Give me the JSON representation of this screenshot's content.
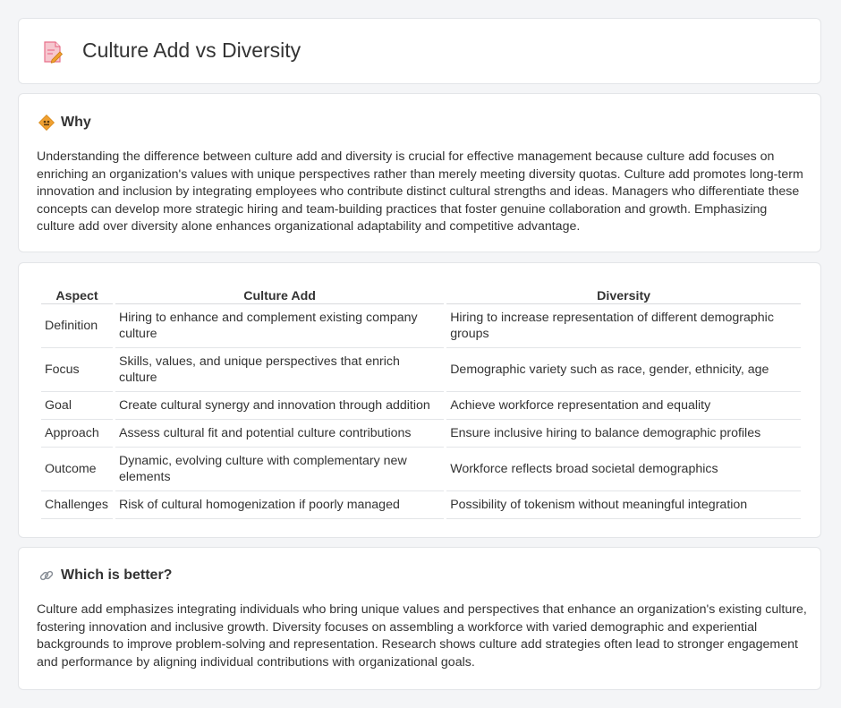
{
  "header": {
    "title": "Culture Add vs Diversity",
    "icon": "document-pencil-icon"
  },
  "why": {
    "title": "Why",
    "icon": "diamond-warning-icon",
    "text": "Understanding the difference between culture add and diversity is crucial for effective management because culture add focuses on enriching an organization's values with unique perspectives rather than merely meeting diversity quotas. Culture add promotes long-term innovation and inclusion by integrating employees who contribute distinct cultural strengths and ideas. Managers who differentiate these concepts can develop more strategic hiring and team-building practices that foster genuine collaboration and growth. Emphasizing culture add over diversity alone enhances organizational adaptability and competitive advantage."
  },
  "table": {
    "headers": [
      "Aspect",
      "Culture Add",
      "Diversity"
    ],
    "rows": [
      {
        "aspect": "Definition",
        "culture_add": "Hiring to enhance and complement existing company culture",
        "diversity": "Hiring to increase representation of different demographic groups"
      },
      {
        "aspect": "Focus",
        "culture_add": "Skills, values, and unique perspectives that enrich culture",
        "diversity": "Demographic variety such as race, gender, ethnicity, age"
      },
      {
        "aspect": "Goal",
        "culture_add": "Create cultural synergy and innovation through addition",
        "diversity": "Achieve workforce representation and equality"
      },
      {
        "aspect": "Approach",
        "culture_add": "Assess cultural fit and potential culture contributions",
        "diversity": "Ensure inclusive hiring to balance demographic profiles"
      },
      {
        "aspect": "Outcome",
        "culture_add": "Dynamic, evolving culture with complementary new elements",
        "diversity": "Workforce reflects broad societal demographics"
      },
      {
        "aspect": "Challenges",
        "culture_add": "Risk of cultural homogenization if poorly managed",
        "diversity": "Possibility of tokenism without meaningful integration"
      }
    ]
  },
  "better": {
    "title": "Which is better?",
    "icon": "link-icon",
    "text": "Culture add emphasizes integrating individuals who bring unique values and perspectives that enhance an organization's existing culture, fostering innovation and inclusive growth. Diversity focuses on assembling a workforce with varied demographic and experiential backgrounds to improve problem-solving and representation. Research shows culture add strategies often lead to stronger engagement and performance by aligning individual contributions with organizational goals."
  },
  "colors": {
    "accent": "#f0a030",
    "icon_pink": "#e8708a",
    "background": "#f4f5f7"
  }
}
